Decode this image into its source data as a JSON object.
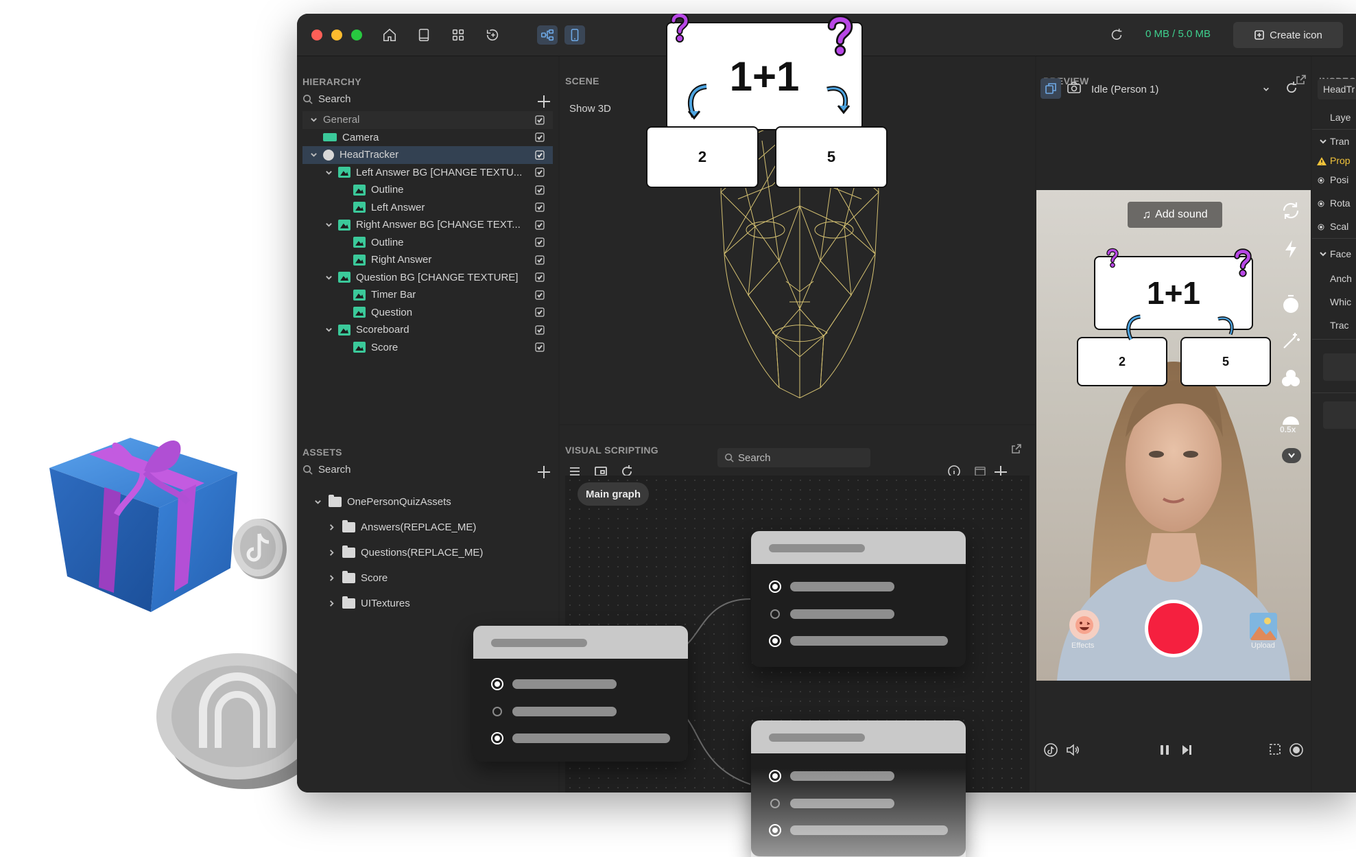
{
  "window": {
    "storage": "0 MB / 5.0 MB",
    "create_icon_label": "Create icon",
    "toolbar_icons": [
      "home-icon",
      "book-icon",
      "grid-icon",
      "refresh-sparkle-icon",
      "graph-icon",
      "phone-icon"
    ]
  },
  "hierarchy": {
    "title": "HIERARCHY",
    "search_placeholder": "Search",
    "items": [
      {
        "label": "General",
        "depth": 0,
        "icon": "none",
        "expand": "open",
        "kind": "header"
      },
      {
        "label": "Camera",
        "depth": 0,
        "icon": "camera",
        "expand": "none"
      },
      {
        "label": "HeadTracker",
        "depth": 0,
        "icon": "head",
        "expand": "open",
        "selected": true
      },
      {
        "label": "Left Answer BG [CHANGE TEXTU...",
        "depth": 1,
        "icon": "image",
        "expand": "open"
      },
      {
        "label": "Outline",
        "depth": 2,
        "icon": "image",
        "expand": "none"
      },
      {
        "label": "Left Answer",
        "depth": 2,
        "icon": "image",
        "expand": "none"
      },
      {
        "label": "Right Answer BG [CHANGE TEXT...",
        "depth": 1,
        "icon": "image",
        "expand": "open"
      },
      {
        "label": "Outline",
        "depth": 2,
        "icon": "image",
        "expand": "none"
      },
      {
        "label": "Right Answer",
        "depth": 2,
        "icon": "image",
        "expand": "none"
      },
      {
        "label": "Question BG [CHANGE TEXTURE]",
        "depth": 1,
        "icon": "image",
        "expand": "open"
      },
      {
        "label": "Timer Bar",
        "depth": 2,
        "icon": "image",
        "expand": "none"
      },
      {
        "label": "Question",
        "depth": 2,
        "icon": "image",
        "expand": "none"
      },
      {
        "label": "Scoreboard",
        "depth": 1,
        "icon": "image",
        "expand": "open"
      },
      {
        "label": "Score",
        "depth": 2,
        "icon": "image",
        "expand": "none"
      }
    ]
  },
  "assets": {
    "title": "ASSETS",
    "search_placeholder": "Search",
    "root": "OnePersonQuizAssets",
    "folders": [
      "Answers(REPLACE_ME)",
      "Questions(REPLACE_ME)",
      "Score",
      "UITextures"
    ]
  },
  "scene": {
    "title": "SCENE",
    "show_3d": "Show 3D",
    "question": "1+1",
    "left_answer": "2",
    "right_answer": "5"
  },
  "scripting": {
    "title": "VISUAL SCRIPTING",
    "search_placeholder": "Search",
    "main_graph": "Main graph"
  },
  "preview": {
    "title": "PREVIEW",
    "selected_option": "Idle (Person 1)",
    "add_sound": "Add sound",
    "question": "1+1",
    "left_answer": "2",
    "right_answer": "5",
    "effects_label": "Effects",
    "upload_label": "Upload",
    "speed_label": "0.5x"
  },
  "inspector": {
    "title": "INSPEC",
    "name_field": "HeadTr",
    "rows": [
      "Laye",
      "Tran",
      "Prop",
      "Posi",
      "Rota",
      "Scal",
      "Face",
      "Anch",
      "Whic",
      "Trac"
    ]
  },
  "colors": {
    "accent_green": "#3fd08e",
    "selection": "#334152",
    "record": "#f5203f",
    "node_icon": "#3bc99a",
    "face_mesh": "#e8d27a",
    "question_mark": "#b847e6"
  }
}
